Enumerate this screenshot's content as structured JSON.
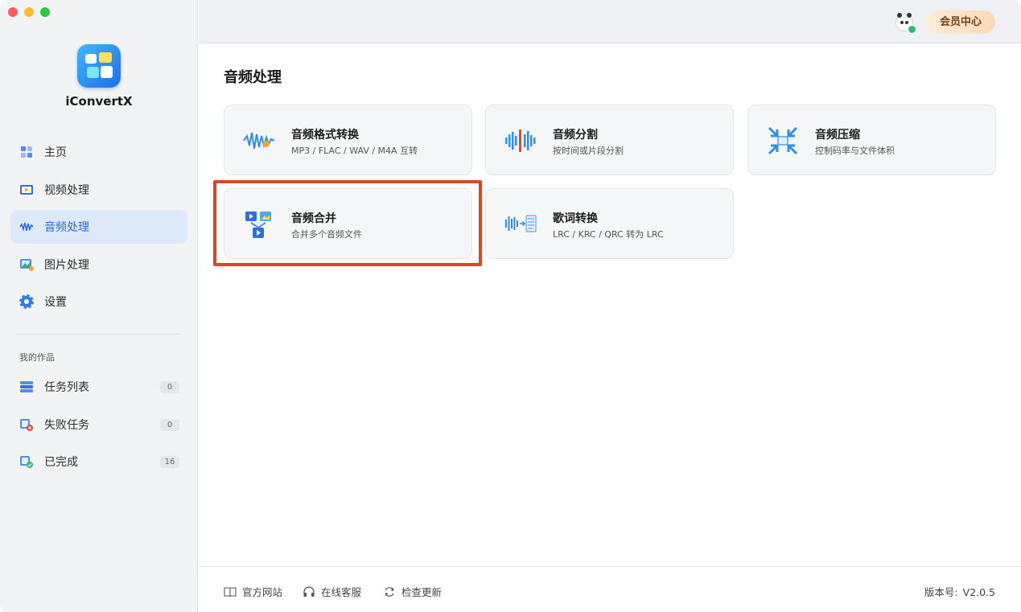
{
  "app": {
    "name": "iConvertX"
  },
  "sidebar": {
    "nav": [
      {
        "label": "主页",
        "icon": "home-icon"
      },
      {
        "label": "视频处理",
        "icon": "video-icon"
      },
      {
        "label": "音频处理",
        "icon": "audio-wave-icon",
        "active": true
      },
      {
        "label": "图片处理",
        "icon": "image-icon"
      },
      {
        "label": "设置",
        "icon": "gear-icon"
      }
    ],
    "works_title": "我的作品",
    "works": [
      {
        "label": "任务列表",
        "count": "0",
        "icon": "task-list-icon"
      },
      {
        "label": "失败任务",
        "count": "0",
        "icon": "failed-task-icon"
      },
      {
        "label": "已完成",
        "count": "16",
        "icon": "completed-icon"
      }
    ]
  },
  "header": {
    "vip_label": "会员中心"
  },
  "main": {
    "title": "音频处理",
    "cards": [
      {
        "title": "音频格式转换",
        "subtitle": "MP3 / FLAC / WAV / M4A 互转",
        "icon": "audio-convert-icon"
      },
      {
        "title": "音频分割",
        "subtitle": "按时间或片段分割",
        "icon": "audio-split-icon"
      },
      {
        "title": "音频压缩",
        "subtitle": "控制码率与文件体积",
        "icon": "audio-compress-icon"
      },
      {
        "title": "音频合并",
        "subtitle": "合并多个音频文件",
        "icon": "audio-merge-icon",
        "highlighted": true
      },
      {
        "title": "歌词转换",
        "subtitle": "LRC / KRC / QRC 转为 LRC",
        "icon": "lyrics-convert-icon"
      }
    ]
  },
  "footer": {
    "links": [
      "官方网站",
      "在线客服",
      "检查更新"
    ],
    "version_label": "版本号:",
    "version": "V2.0.5"
  },
  "colors": {
    "accent": "#2b6ad8",
    "highlight": "#d34a2b",
    "sidebar_bg": "#f2f3f5"
  }
}
